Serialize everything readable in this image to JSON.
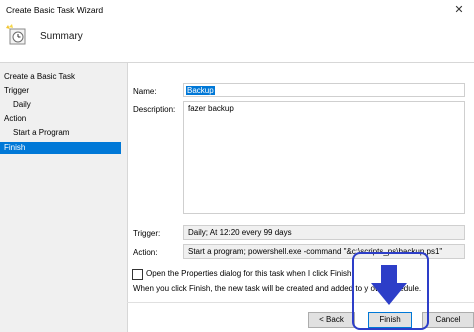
{
  "window": {
    "title": "Create Basic Task Wizard",
    "close_glyph": "✕"
  },
  "header": {
    "title": "Summary",
    "icon": "task-scheduler-icon"
  },
  "sidebar": {
    "items": [
      {
        "label": "Create a Basic Task"
      },
      {
        "label": "Trigger"
      },
      {
        "label": "Daily"
      },
      {
        "label": "Action"
      },
      {
        "label": "Start a Program"
      },
      {
        "label": "Finish"
      }
    ]
  },
  "form": {
    "name_label": "Name:",
    "name_value": "Backup",
    "description_label": "Description:",
    "description_value": "fazer backup",
    "trigger_label": "Trigger:",
    "trigger_value": "Daily; At 12:20 every 99 days",
    "action_label": "Action:",
    "action_value": "Start a program; powershell.exe -command \"&c:\\scripts_ps\\backup.ps1\"",
    "properties_checkbox_label": "Open the Properties dialog for this task when I click Finish",
    "properties_checked": false,
    "info_text": "When you click Finish, the new task will be created and added to y    ows schedule."
  },
  "buttons": {
    "back": "< Back",
    "finish": "Finish",
    "cancel": "Cancel"
  },
  "colors": {
    "selection": "#0078d7",
    "annotation": "#2d3ec8"
  }
}
